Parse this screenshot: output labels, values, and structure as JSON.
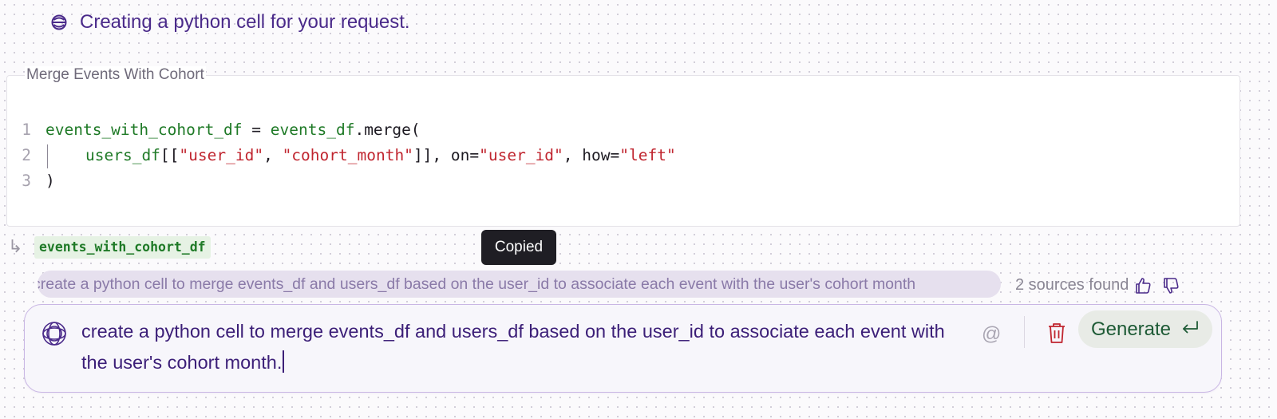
{
  "status": {
    "text": "Creating a python cell for your request.",
    "icon": "agent-logo-icon"
  },
  "cell": {
    "title": "Merge Events With Cohort",
    "lines": [
      {
        "number": "1"
      },
      {
        "number": "2"
      },
      {
        "number": "3"
      }
    ],
    "code_tokens": {
      "l1_var": "events_with_cohort_df",
      "l1_eq": " = ",
      "l1_obj": "events_df",
      "l1_method": ".merge(",
      "l2_var": "users_df",
      "l2_open": "[[",
      "l2_s1": "\"user_id\"",
      "l2_comma": ", ",
      "l2_s2": "\"cohort_month\"",
      "l2_close": "]], on=",
      "l2_s3": "\"user_id\"",
      "l2_how": ", how=",
      "l2_s4": "\"left\"",
      "l3_close": ")"
    }
  },
  "output": {
    "variable": "events_with_cohort_df",
    "icon": "return-arrow-icon"
  },
  "tooltip": {
    "text": "Copied"
  },
  "history": {
    "prompt": "create a python cell to merge events_df and users_df based on the user_id to associate each event with the user's cohort month",
    "sources": "2 sources found",
    "thumbs_up_icon": "thumbs-up-icon",
    "thumbs_down_icon": "thumbs-down-icon"
  },
  "composer": {
    "value": "create a python cell to merge events_df and users_df based on the user_id to associate each event with the user's cohort month.",
    "at_label": "@",
    "generate_label": "Generate",
    "icons": [
      "at-icon",
      "trash-icon",
      "enter-icon"
    ]
  },
  "colors": {
    "accent_purple": "#3c1f78",
    "code_green": "#1f7a27",
    "code_red": "#c0252f",
    "generate_text": "#1d5a35",
    "trash_red": "#c0252f"
  }
}
